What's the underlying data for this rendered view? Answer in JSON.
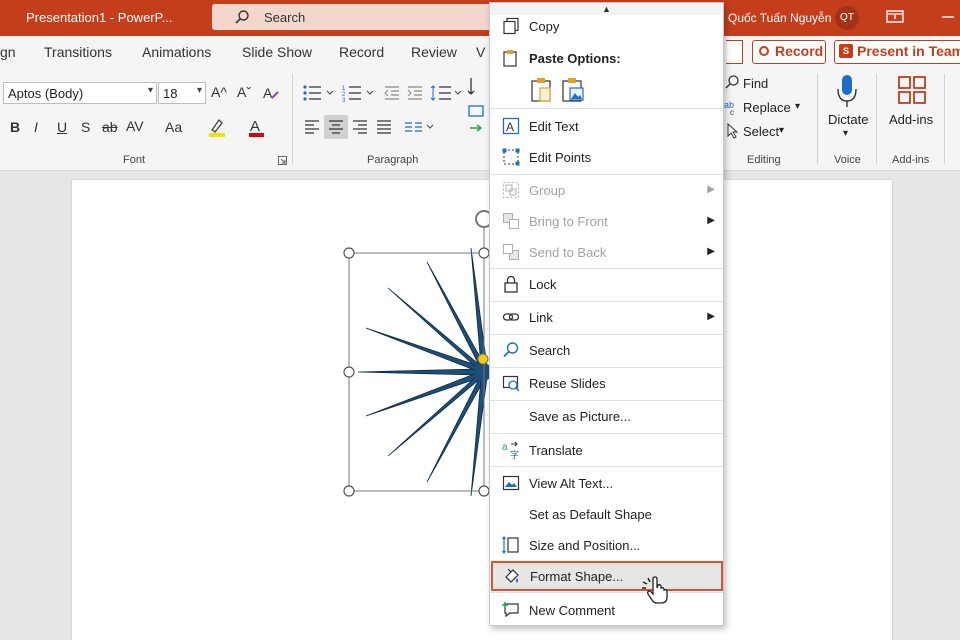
{
  "titlebar": {
    "doc_title": "Presentation1  -  PowerP...",
    "search_label": "Search",
    "user_name": "Quốc Tuấn Nguyễn",
    "avatar_initials": "QT"
  },
  "tabs": [
    "gn",
    "Transitions",
    "Animations",
    "Slide Show",
    "Record",
    "Review",
    "V"
  ],
  "pills": {
    "record": "Record",
    "present_in_teams": "Present in Teams",
    "teams_icon_letter": "S"
  },
  "ribbon": {
    "font_name": "Aptos (Body)",
    "font_size": "18",
    "font_group_label": "Font",
    "paragraph_group_label": "Paragraph",
    "editing": {
      "find": "Find",
      "replace": "Replace",
      "select": "Select",
      "label": "Editing"
    },
    "voice": {
      "dictate": "Dictate",
      "label": "Voice"
    },
    "addins": {
      "button": "Add-ins",
      "label": "Add-ins"
    },
    "grow_font": "A^",
    "shrink_font": "Aˇ",
    "bold": "B",
    "italic": "I",
    "underline": "U",
    "shadow": "S",
    "strike": "ab",
    "spacing": "AV",
    "case": "Aa",
    "font_color": "A"
  },
  "context_menu": {
    "items": [
      {
        "label": "Copy",
        "icon": "copy-icon",
        "disabled": false,
        "submenu": false
      },
      {
        "label": "Paste Options:",
        "icon": "paste-icon",
        "disabled": false,
        "submenu": false,
        "bold": true
      },
      {
        "label": "Edit Text",
        "icon": "edit-text-icon",
        "disabled": false,
        "submenu": false
      },
      {
        "label": "Edit Points",
        "icon": "edit-points-icon",
        "disabled": false,
        "submenu": false
      },
      {
        "label": "Group",
        "icon": "group-icon",
        "disabled": true,
        "submenu": true
      },
      {
        "label": "Bring to Front",
        "icon": "bring-front-icon",
        "disabled": true,
        "submenu": true
      },
      {
        "label": "Send to Back",
        "icon": "send-back-icon",
        "disabled": true,
        "submenu": true
      },
      {
        "label": "Lock",
        "icon": "lock-icon",
        "disabled": false,
        "submenu": false
      },
      {
        "label": "Link",
        "icon": "link-icon",
        "disabled": false,
        "submenu": true
      },
      {
        "label": "Search",
        "icon": "search-icon",
        "disabled": false,
        "submenu": false
      },
      {
        "label": "Reuse Slides",
        "icon": "reuse-slides-icon",
        "disabled": false,
        "submenu": false
      },
      {
        "label": "Save as Picture...",
        "icon": "",
        "disabled": false,
        "submenu": false
      },
      {
        "label": "Translate",
        "icon": "translate-icon",
        "disabled": false,
        "submenu": false
      },
      {
        "label": "View Alt Text...",
        "icon": "alt-text-icon",
        "disabled": false,
        "submenu": false
      },
      {
        "label": "Set as Default Shape",
        "icon": "",
        "disabled": false,
        "submenu": false
      },
      {
        "label": "Size and Position...",
        "icon": "size-position-icon",
        "disabled": false,
        "submenu": false
      },
      {
        "label": "Format Shape...",
        "icon": "format-shape-icon",
        "disabled": false,
        "submenu": false,
        "highlighted": true
      },
      {
        "label": "New Comment",
        "icon": "new-comment-icon",
        "disabled": false,
        "submenu": false
      }
    ]
  },
  "colors": {
    "titlebar": "#c43e1c",
    "highlight_border": "#e0532a",
    "star_fill": "#1f4e79",
    "accent_blue": "#1e6ec8"
  }
}
